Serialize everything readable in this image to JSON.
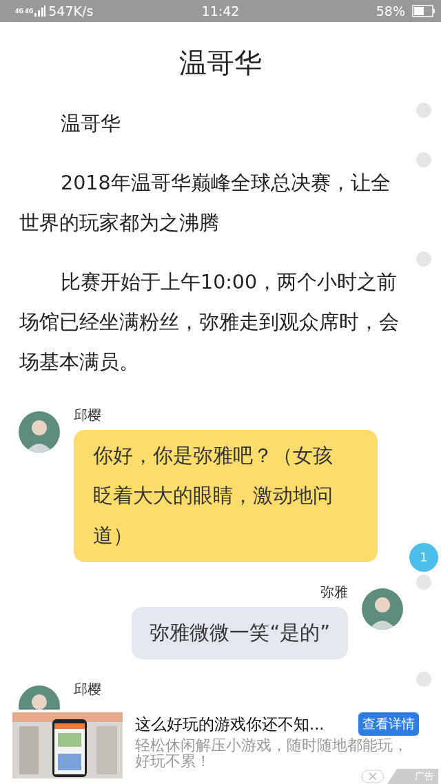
{
  "status_bar": {
    "network": [
      "4G",
      "4G"
    ],
    "speed": "547K/s",
    "time": "11:42",
    "battery": "58%"
  },
  "title": "温哥华",
  "paragraphs": [
    {
      "text": "温哥华",
      "dot": true
    },
    {
      "text": "2018年温哥华巅峰全球总决赛，让全世界的玩家都为之沸腾",
      "dot": true
    },
    {
      "text": "比赛开始于上午10:00，两个小时之前场馆已经坐满粉丝，弥雅走到观众席时，会场基本满员。",
      "dot": true
    }
  ],
  "messages": [
    {
      "kind": "incoming",
      "name": "邱樱",
      "text": "你好，你是弥雅吧？（女孩眨着大大的眼睛，激动地问道）",
      "badge": "1"
    },
    {
      "kind": "outgoing",
      "name": "弥雅",
      "text": "弥雅微微一笑“是的”",
      "dot": true
    },
    {
      "kind": "incoming",
      "name": "邱樱",
      "dot": true
    }
  ],
  "ad": {
    "title": "这么好玩的游戏你还不知...",
    "button": "查看详情",
    "description": "轻松休闲解压小游戏，随时随地都能玩，好玩不累！",
    "label": "广告"
  }
}
